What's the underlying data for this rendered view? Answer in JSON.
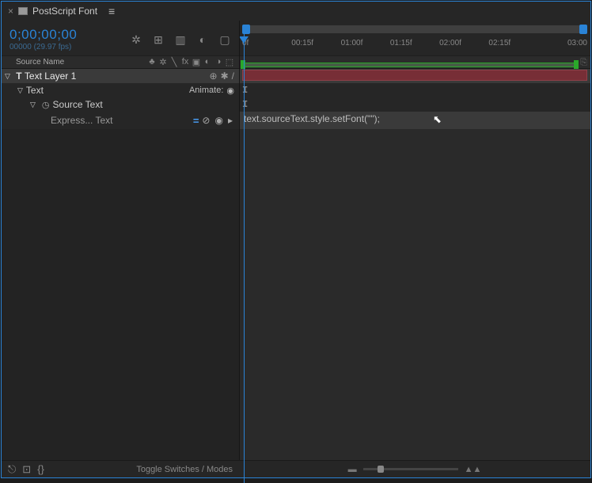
{
  "tab": {
    "close": "×",
    "title": "PostScript Font"
  },
  "timecode": "0;00;00;00",
  "fps": "00000 (29.97 fps)",
  "column_header": "Source Name",
  "ruler_labels": [
    "0f",
    "00:15f",
    "01:00f",
    "01:15f",
    "02:00f",
    "02:15f",
    "03:00"
  ],
  "layer": {
    "name": "Text Layer 1",
    "prop_text": "Text",
    "animate_label": "Animate:",
    "source_text": "Source Text",
    "expression_label": "Express... Text"
  },
  "expression_code": "text.sourceText.style.setFont(\"\");",
  "bottom": {
    "toggle_label": "Toggle Switches / Modes"
  }
}
